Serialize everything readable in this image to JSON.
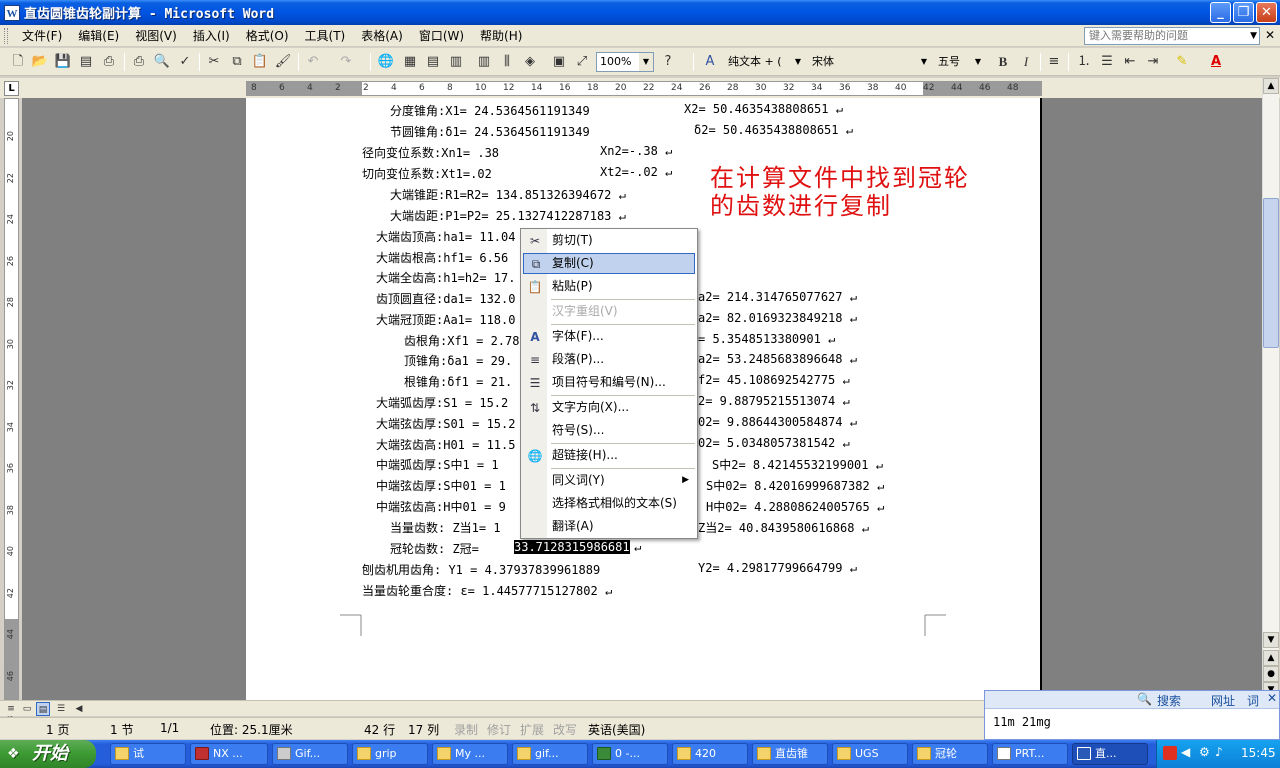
{
  "window": {
    "title": "直齿圆锥齿轮副计算 - Microsoft Word",
    "app_icon_letter": "W",
    "buttons": {
      "minimize": "_",
      "maximize": "❐",
      "close": "✕"
    }
  },
  "menubar": {
    "items": [
      "文件(F)",
      "编辑(E)",
      "视图(V)",
      "插入(I)",
      "格式(O)",
      "工具(T)",
      "表格(A)",
      "窗口(W)",
      "帮助(H)"
    ],
    "help_placeholder": "键入需要帮助的问题",
    "close_glyph": "✕"
  },
  "toolbar": {
    "zoom": "100%",
    "style": "纯文本 + (",
    "font": "宋体",
    "size": "五号",
    "bold": "B",
    "italic": "I",
    "font_color": "A",
    "icons": [
      "new-icon",
      "open-icon",
      "save-icon",
      "permission-icon",
      "print-icon",
      "print-preview-icon",
      "spelling-icon",
      "cut-icon",
      "copy-icon",
      "paste-icon",
      "format-painter-icon",
      "undo-icon",
      "redo-icon",
      "hyperlink-icon",
      "table-icon",
      "columns-icon",
      "drawing-icon",
      "document-map-icon",
      "show-hide-icon",
      "help-icon",
      "styles-icon",
      "align-justify-icon",
      "numbering-icon",
      "bullets-icon",
      "decrease-indent-icon",
      "increase-indent-icon",
      "highlight-icon"
    ]
  },
  "ruler": {
    "h_ticks": [
      "8",
      "6",
      "4",
      "2",
      "2",
      "4",
      "6",
      "8",
      "10",
      "12",
      "14",
      "16",
      "18",
      "20",
      "22",
      "24",
      "26",
      "28",
      "30",
      "32",
      "34",
      "36",
      "38",
      "40",
      "42",
      "44",
      "46",
      "48"
    ],
    "v_ticks": [
      "20",
      "22",
      "24",
      "26",
      "28",
      "30",
      "32",
      "34",
      "36",
      "38",
      "40",
      "42",
      "44",
      "46",
      "48"
    ],
    "corner": "L"
  },
  "document": {
    "lines": [
      "分度锥角:X1= 24.5364561191349",
      "X2= 50.4635438808651 ↵",
      "节圆锥角:δ1= 24.5364561191349",
      "δ2= 50.4635438808651 ↵",
      "径向变位系数:Xn1= .38",
      "Xn2=-.38 ↵",
      "切向变位系数:Xt1=.02",
      "Xt2=-.02 ↵",
      "大端锥距:R1=R2= 134.851326394672 ↵",
      "大端齿距:P1=P2= 25.1327412287183 ↵",
      "大端齿顶高:ha1= 11.04",
      "大端齿根高:hf1= 6.56",
      "大端全齿高:h1=h2= 17.",
      "齿顶圆直径:da1= 132.0",
      "a2= 214.314765077627 ↵",
      "大端冠顶距:Aa1= 118.0",
      "a2= 82.0169323849218 ↵",
      "齿根角:Xf1 = 2.78",
      "= 5.3548513380901 ↵",
      "顶锥角:δa1 = 29.",
      "a2= 53.2485683896648 ↵",
      "根锥角:δf1 = 21.",
      "f2= 45.108692542775 ↵",
      "大端弧齿厚:S1  = 15.2",
      "2= 9.88795215513074 ↵",
      "大端弦齿厚:S01 = 15.2",
      "02= 9.88644300584874 ↵",
      "大端弦齿高:H01 = 11.5",
      "02= 5.0348057381542 ↵",
      "中端弧齿厚:S中1  = 1",
      "S中2= 8.42145532199001 ↵",
      "中端弦齿厚:S中01 = 1",
      "S中02= 8.42016999687382 ↵",
      "中端弦齿高:H中01 = 9",
      "H中02= 4.28808624005765 ↵",
      "当量齿数: Z当1= 1",
      "Z当2= 40.8439580616868 ↵",
      "冠轮齿数:  Z冠=",
      "33.7128315986681",
      "↵",
      "刨齿机用齿角:  Y1  = 4.37937839961889",
      "Y2= 4.29817799664799 ↵",
      "当量齿轮重合度:  ε= 1.44577715127802 ↵"
    ],
    "annotation": [
      "在计算文件中找到冠轮",
      "的齿数进行复制"
    ]
  },
  "context_menu": {
    "items": [
      {
        "label": "剪切(T)",
        "icon": "cut-icon",
        "glyph": "✂"
      },
      {
        "label": "复制(C)",
        "icon": "copy-icon",
        "glyph": "⧉"
      },
      {
        "label": "粘贴(P)",
        "icon": "paste-icon",
        "glyph": "📋"
      },
      {
        "label": "汉字重组(V)",
        "icon": "",
        "glyph": ""
      },
      {
        "label": "字体(F)...",
        "icon": "font-icon",
        "glyph": "A"
      },
      {
        "label": "段落(P)...",
        "icon": "paragraph-icon",
        "glyph": "≡"
      },
      {
        "label": "项目符号和编号(N)...",
        "icon": "bullets-icon",
        "glyph": "☰"
      },
      {
        "label": "文字方向(X)...",
        "icon": "text-direction-icon",
        "glyph": "⇅"
      },
      {
        "label": "符号(S)...",
        "icon": "",
        "glyph": ""
      },
      {
        "label": "超链接(H)...",
        "icon": "hyperlink-icon",
        "glyph": "🌐"
      },
      {
        "label": "同义词(Y)",
        "icon": "",
        "glyph": ""
      },
      {
        "label": "选择格式相似的文本(S)",
        "icon": "",
        "glyph": ""
      },
      {
        "label": "翻译(A)",
        "icon": "",
        "glyph": ""
      }
    ],
    "submenu_arrow": "▶"
  },
  "statusbar": {
    "page": "1 页",
    "section": "1 节",
    "pages": "1/1",
    "position": "位置: 25.1厘米",
    "line": "42 行",
    "column": "17 列",
    "rec": "录制",
    "trk": "修订",
    "ext": "扩展",
    "ovr": "改写",
    "language": "英语(美国)"
  },
  "ime": {
    "search": "搜索",
    "urls": "网址",
    "words": "词",
    "text": "11m 21mg"
  },
  "taskbar": {
    "start": "开始",
    "tasks": [
      "试",
      "NX ...",
      "Gif...",
      "grip",
      "My ...",
      "gif...",
      "0 -...",
      "420",
      "直齿锥",
      "UGS",
      "冠轮",
      "PRT...",
      "直..."
    ],
    "clock": "15:45"
  },
  "colors": {
    "annotation": "#e01010",
    "menu_highlight": "#c1d2ee",
    "titlebar": "#0054e3"
  }
}
